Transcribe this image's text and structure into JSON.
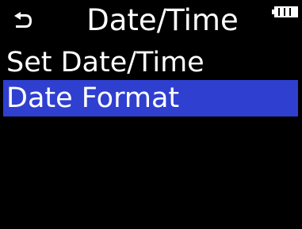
{
  "header": {
    "back_icon": "return-arrow-icon",
    "title": "Date/Time",
    "battery_icon": "battery-icon"
  },
  "menu": {
    "items": [
      {
        "label": "Set Date/Time",
        "selected": false
      },
      {
        "label": "Date Format",
        "selected": true
      }
    ]
  },
  "colors": {
    "background": "#000000",
    "text": "#ffffff",
    "selection": "#2f3fd0"
  }
}
